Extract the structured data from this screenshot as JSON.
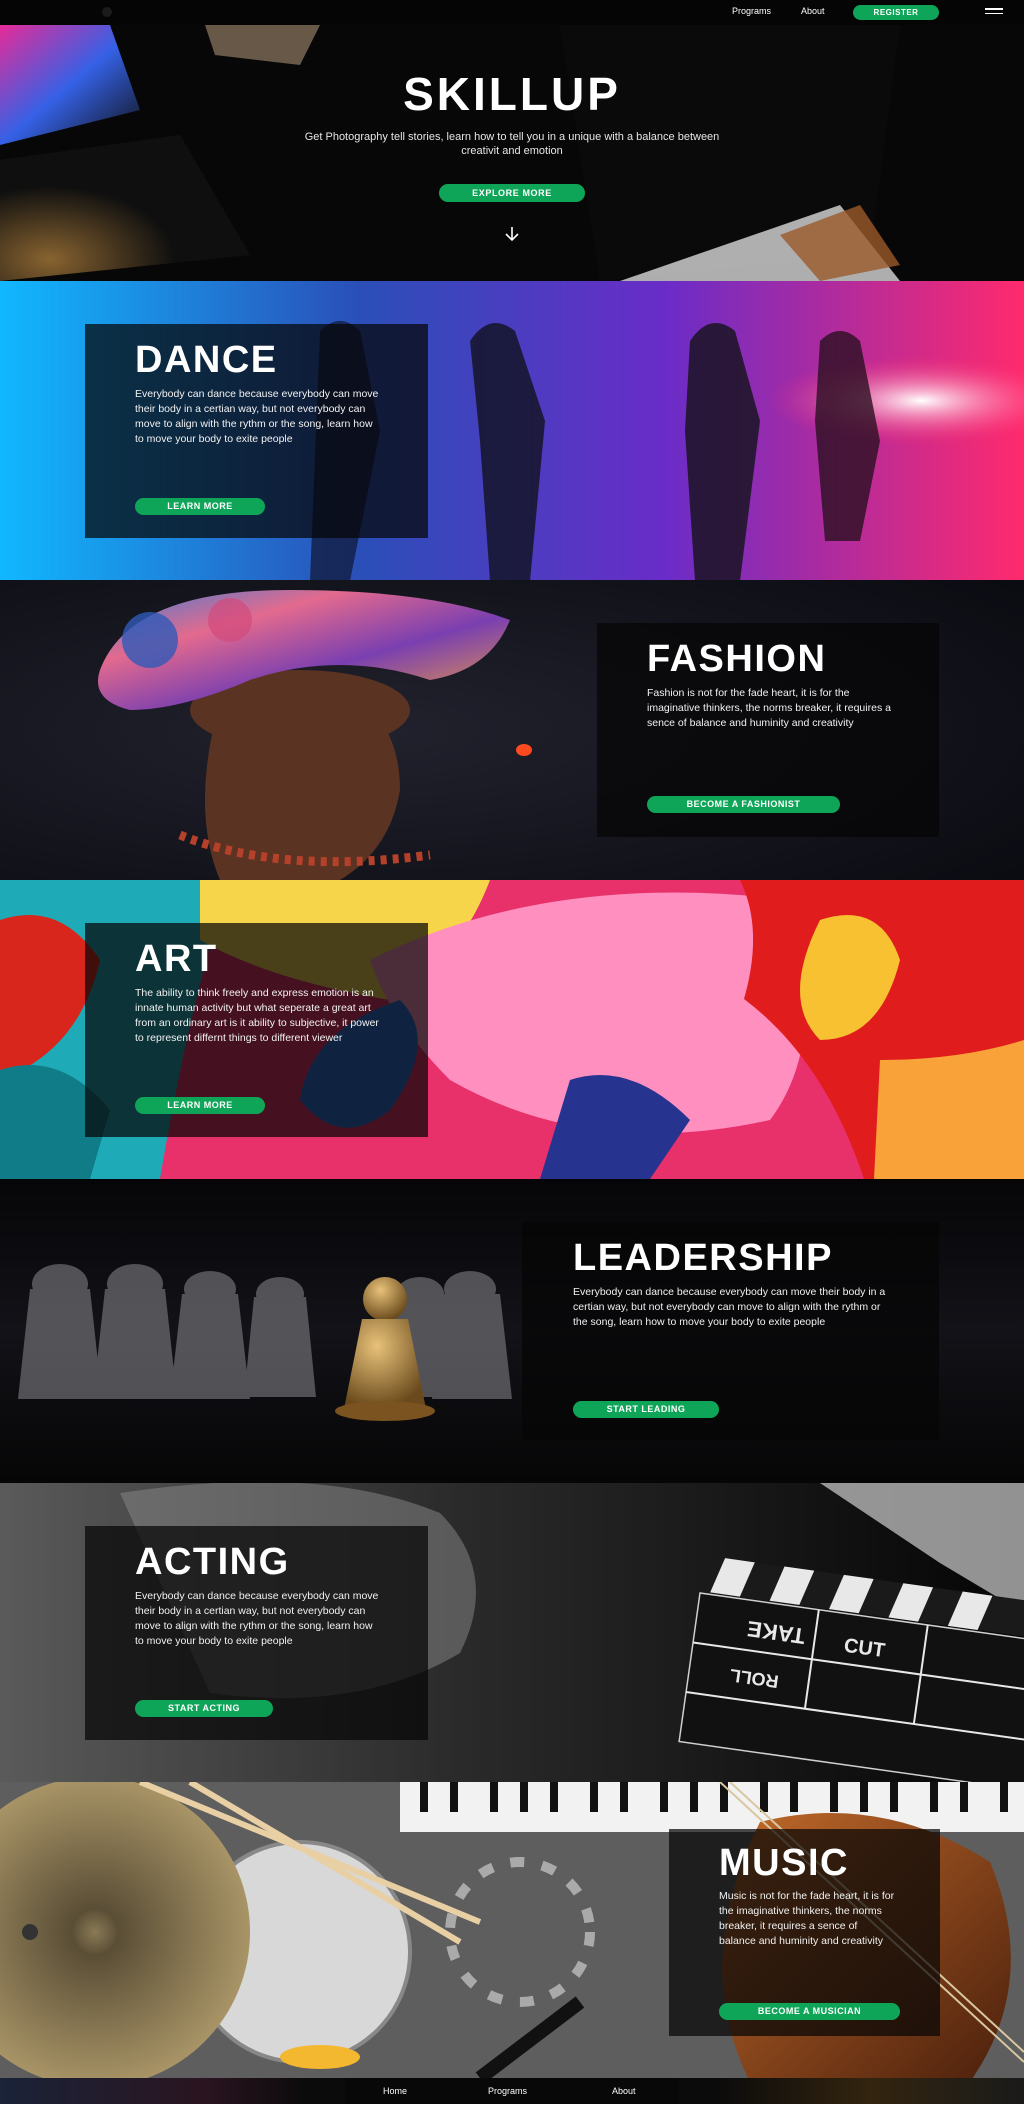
{
  "nav": {
    "links": [
      "Programs",
      "About"
    ],
    "register_label": "REGISTER"
  },
  "hero": {
    "title": "SKILLUP",
    "subtitle": "Get Photography tell stories, learn how to tell you in a unique with a balance between creativit and emotion",
    "button_label": "EXPLORE MORE"
  },
  "sections": [
    {
      "title": "DANCE",
      "text": "Everybody can dance because everybody can move their body in a certian way, but not everybody can move to align with the rythm or the song, learn how to move your body to exite people",
      "button": "LEARN MORE"
    },
    {
      "title": "FASHION",
      "text": "Fashion is not for the fade heart, it is for the imaginative thinkers, the norms breaker, it requires a sence of balance and huminity and creativity",
      "button": "BECOME A FASHIONIST"
    },
    {
      "title": "ART",
      "text": "The ability to think freely and express emotion is an innate human activity but what seperate a great art from an ordinary art is it ability to subjective, it power to represent differnt things to different viewer",
      "button": "LEARN MORE"
    },
    {
      "title": "LEADERSHIP",
      "text": "Everybody can dance because everybody can move their body in a certian way, but not everybody can move to align with the rythm or the song, learn how to move your body to exite people",
      "button": "START LEADING"
    },
    {
      "title": "ACTING",
      "text": "Everybody can dance because everybody can move their body in a certian way, but not everybody can move to align with the rythm or the song, learn how to move your body to exite people",
      "button": "START ACTING"
    },
    {
      "title": "MUSIC",
      "text": "Music is not for the fade heart, it is for the imaginative thinkers, the norms breaker, it requires a sence of balance and huminity and creativity",
      "button": "BECOME A MUSICIAN"
    }
  ],
  "clapper_words": [
    "TAKE",
    "CUT",
    "ROLL"
  ],
  "footer": {
    "links": [
      "Home",
      "Programs",
      "About"
    ]
  },
  "colors": {
    "accent": "#0fa558",
    "background": "#000000"
  }
}
